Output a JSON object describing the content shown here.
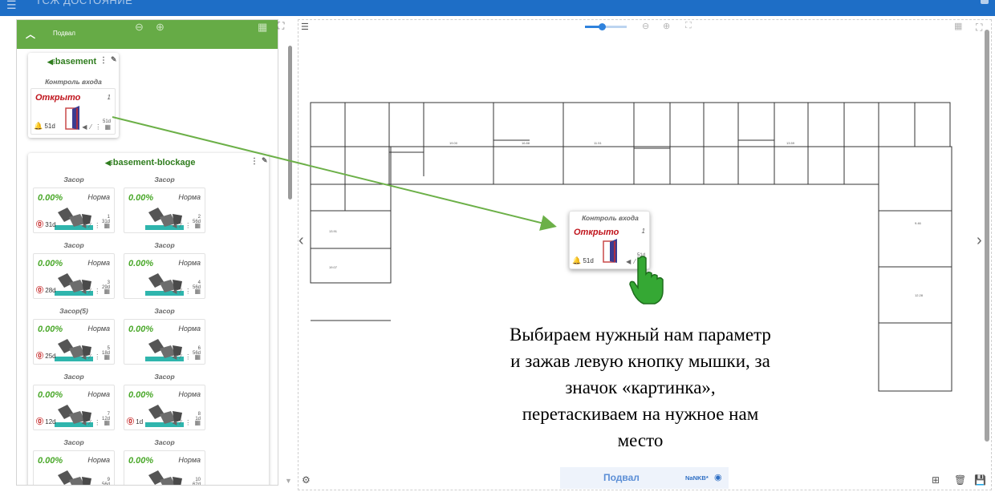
{
  "app": {
    "title": "ТСЖ ДОСТОЯНИЕ",
    "floor": "Подвал"
  },
  "sidebar": {
    "floor_title": "Подвал"
  },
  "device_basement": {
    "name": "basement",
    "widget": {
      "title": "Контроль входа",
      "status": "Открыто",
      "status_color": "#c0141c",
      "number": "1",
      "age": "51d",
      "alarm": "51d"
    }
  },
  "device_blockage": {
    "name": "basement-blockage",
    "widgets": [
      {
        "title": "Засор",
        "value": "0.00%",
        "status": "Норма",
        "number": "1",
        "age": "31d",
        "alarm": "31d"
      },
      {
        "title": "Засор",
        "value": "0.00%",
        "status": "Норма",
        "number": "2",
        "age": "56d",
        "alarm": ""
      },
      {
        "title": "Засор",
        "value": "0.00%",
        "status": "Норма",
        "number": "3",
        "age": "29d",
        "alarm": "28d"
      },
      {
        "title": "Засор",
        "value": "0.00%",
        "status": "Норма",
        "number": "4",
        "age": "56d",
        "alarm": ""
      },
      {
        "title": "Засор(5)",
        "value": "0.00%",
        "status": "Норма",
        "number": "5",
        "age": "18d",
        "alarm": "25d"
      },
      {
        "title": "Засор",
        "value": "0.00%",
        "status": "Норма",
        "number": "6",
        "age": "56d",
        "alarm": ""
      },
      {
        "title": "Засор",
        "value": "0.00%",
        "status": "Норма",
        "number": "7",
        "age": "12d",
        "alarm": "12d"
      },
      {
        "title": "Засор",
        "value": "0.00%",
        "status": "Норма",
        "number": "8",
        "age": "1d",
        "alarm": "1d"
      },
      {
        "title": "Засор",
        "value": "0.00%",
        "status": "Норма",
        "number": "9",
        "age": "56d",
        "alarm": ""
      },
      {
        "title": "Засор",
        "value": "0.00%",
        "status": "Норма",
        "number": "10",
        "age": "62d",
        "alarm": ""
      }
    ]
  },
  "plan": {
    "dragged_widget": {
      "title": "Контроль входа",
      "status": "Открыто",
      "number": "1",
      "age": "51d",
      "alarm": "51d"
    },
    "floor_label": "Подвал",
    "nankb": "NaNKB*"
  },
  "instruction": {
    "line1": "Выбираем нужный нам параметр",
    "line2": "и зажав левую кнопку мышки, за",
    "line3": "значок «картинка»,",
    "line4": "перетаскиваем на нужное нам",
    "line5": "место"
  },
  "colors": {
    "header": "#1e6ec6",
    "panel_header": "#66ab46",
    "device_name": "#2f7d1e",
    "arrow": "#6cb048",
    "value_green": "#4aa82a",
    "accent_blue": "#2f82dd"
  }
}
